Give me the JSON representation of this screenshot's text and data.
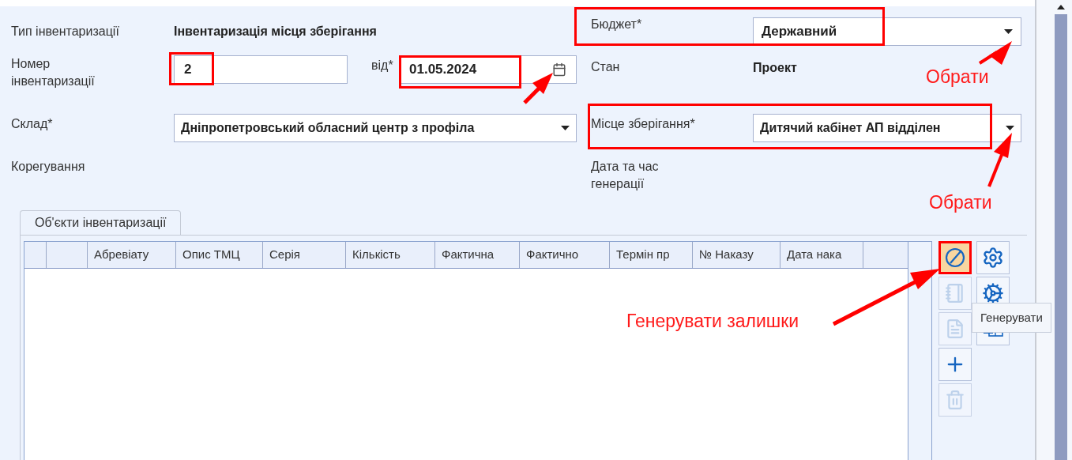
{
  "form": {
    "inventory_type": {
      "label": "Тип інвентаризації",
      "value": "Інвентаризація місця зберігання"
    },
    "number": {
      "label": "Номер інвентаризації",
      "value": "2",
      "marked": true
    },
    "date": {
      "label": "від*",
      "value": "01.05.2024",
      "marked": true
    },
    "warehouse": {
      "label": "Склад*",
      "value": "Дніпропетровський обласний центр з профіла"
    },
    "correction": {
      "label": "Корегування"
    },
    "budget": {
      "label": "Бюджет*",
      "value": "Державний",
      "marked": true
    },
    "state": {
      "label": "Стан",
      "value": "Проект"
    },
    "storage_place": {
      "label": "Місце зберігання*",
      "value": "Дитячий кабінет АП відділен",
      "marked": true
    },
    "generated_at": {
      "label": "Дата та час генерації"
    }
  },
  "tabs": [
    {
      "label": "Об'єкти інвентаризації",
      "selected": true
    }
  ],
  "table": {
    "columns": [
      "Абревіату",
      "Опис ТМЦ",
      "Серія",
      "Кількість",
      "Фактична",
      "Фактично",
      "Термін пр",
      "№ Наказу",
      "Дата нака"
    ]
  },
  "toolbar": [
    {
      "kind": "generate",
      "disabled": false,
      "highlighted": true,
      "marked": true
    },
    {
      "kind": "notebook",
      "disabled": true,
      "highlighted": false,
      "marked": false
    },
    {
      "kind": "document-info",
      "disabled": true,
      "highlighted": false,
      "marked": false
    },
    {
      "kind": "add",
      "disabled": false,
      "highlighted": false,
      "marked": false
    },
    {
      "kind": "delete",
      "disabled": true,
      "highlighted": false,
      "marked": false
    },
    {
      "kind": "settings",
      "disabled": false,
      "highlighted": false,
      "marked": false
    },
    {
      "kind": "settings-alt",
      "disabled": false,
      "highlighted": false,
      "marked": false
    },
    {
      "kind": "excel",
      "disabled": false,
      "highlighted": false,
      "marked": false
    }
  ],
  "tooltip": {
    "text": "Генерувати"
  },
  "annotations": [
    {
      "kind": "budget",
      "text": "Обрати"
    },
    {
      "kind": "storage",
      "text": "Обрати"
    },
    {
      "kind": "generate",
      "text": "Генерувати залишки"
    }
  ]
}
